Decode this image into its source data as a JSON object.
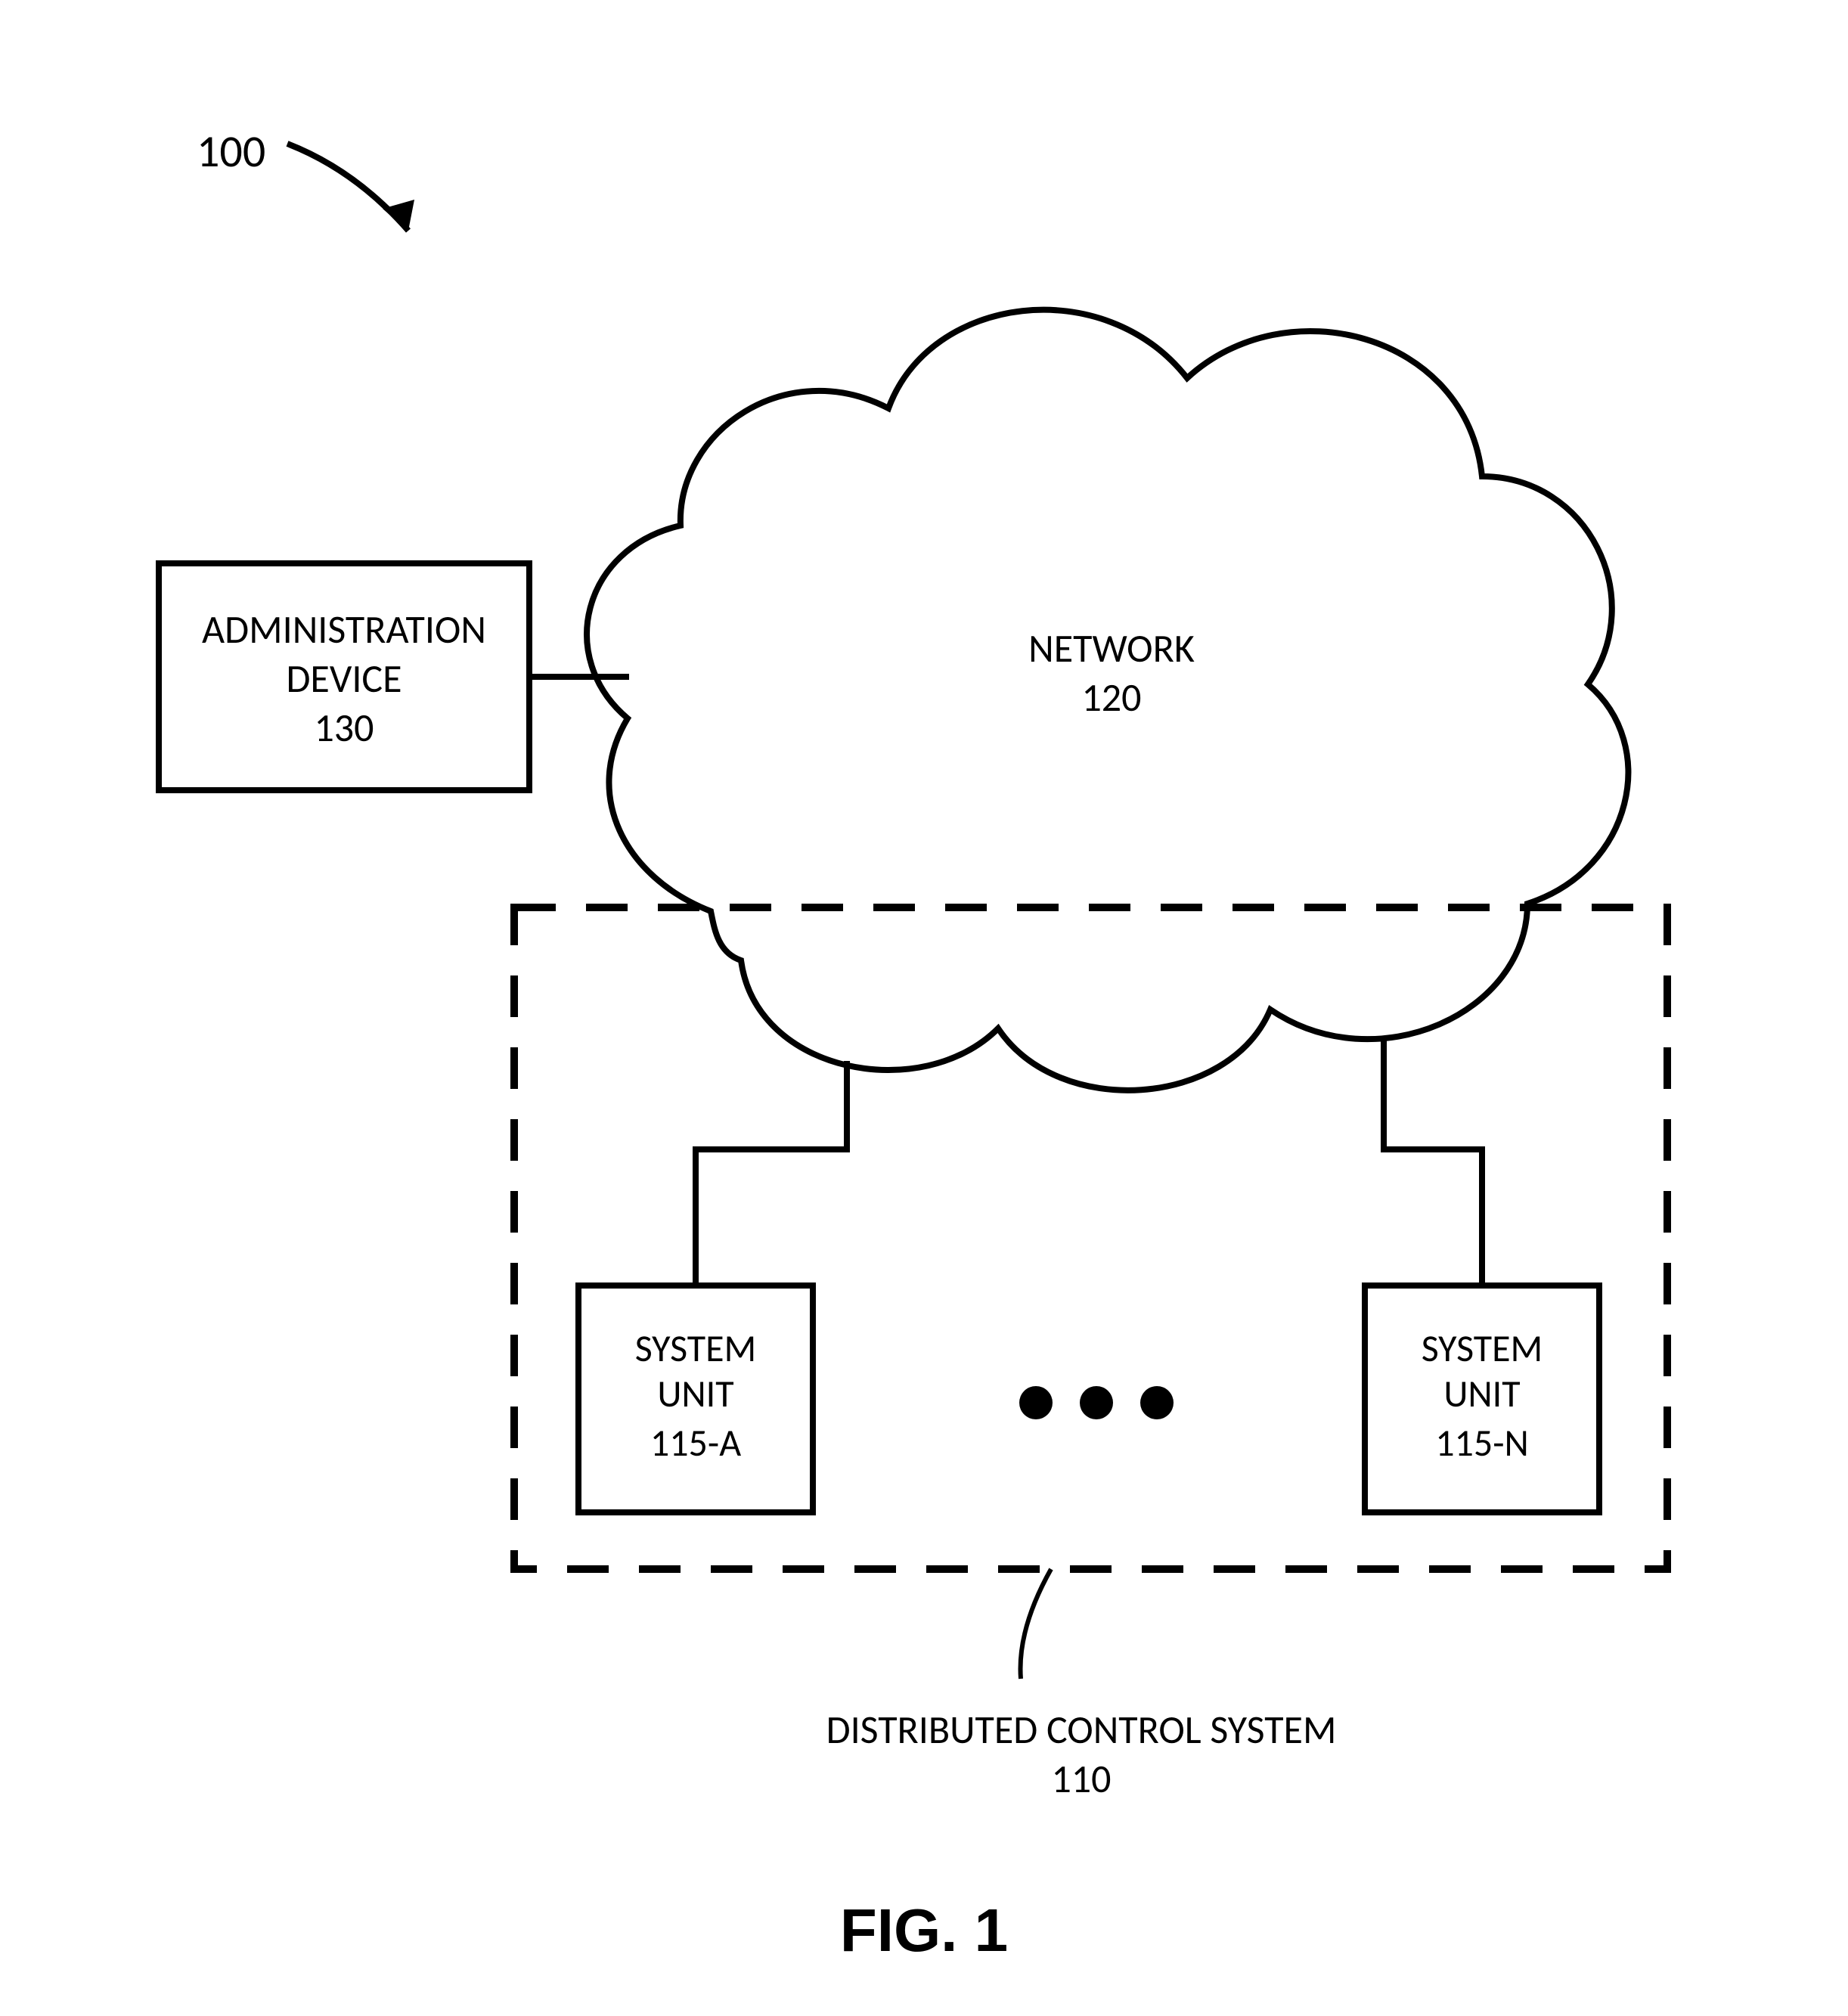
{
  "figure_ref": "100",
  "admin_device": {
    "line1": "ADMINISTRATION",
    "line2": "DEVICE",
    "num": "130"
  },
  "network": {
    "label": "NETWORK",
    "num": "120"
  },
  "dcs": {
    "label": "DISTRIBUTED CONTROL SYSTEM",
    "num": "110"
  },
  "unit_a": {
    "line1": "SYSTEM",
    "line2": "UNIT",
    "num": "115-A"
  },
  "unit_n": {
    "line1": "SYSTEM",
    "line2": "UNIT",
    "num": "115-N"
  },
  "fig_title": "FIG. 1"
}
